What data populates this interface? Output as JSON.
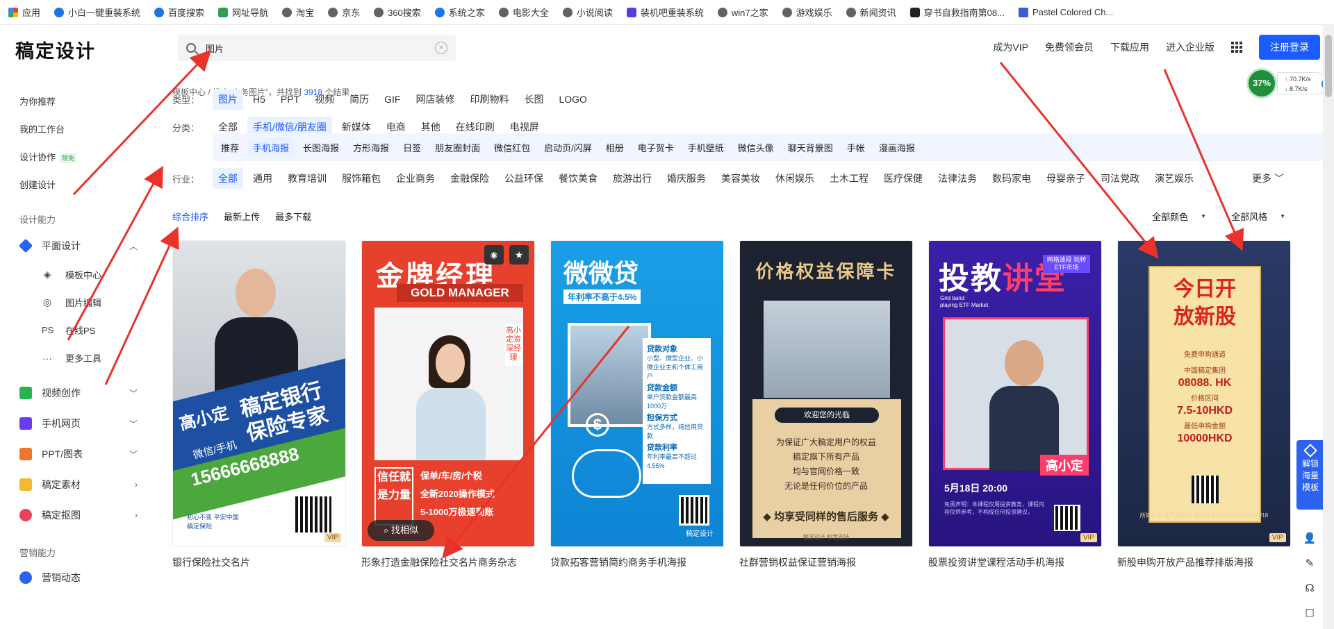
{
  "bookmarks": [
    {
      "label": "应用",
      "icon": "apps-icon"
    },
    {
      "label": "小白一键重装系统",
      "icon": "globe-icon"
    },
    {
      "label": "百度搜索",
      "icon": "baidu-paw-icon"
    },
    {
      "label": "网址导航",
      "icon": "nav-icon"
    },
    {
      "label": "淘宝",
      "icon": "globe-icon"
    },
    {
      "label": "京东",
      "icon": "globe-icon"
    },
    {
      "label": "360搜索",
      "icon": "globe-icon"
    },
    {
      "label": "系统之家",
      "icon": "globe-icon"
    },
    {
      "label": "电影大全",
      "icon": "globe-icon"
    },
    {
      "label": "小说阅读",
      "icon": "globe-icon"
    },
    {
      "label": "装机吧重装系统",
      "icon": "system-icon"
    },
    {
      "label": "win7之家",
      "icon": "globe-icon"
    },
    {
      "label": "游戏娱乐",
      "icon": "globe-icon"
    },
    {
      "label": "新闻资讯",
      "icon": "globe-icon"
    },
    {
      "label": "穿书自救指南第08...",
      "icon": "book-icon"
    },
    {
      "label": "Pastel Colored Ch...",
      "icon": "pastel-icon"
    }
  ],
  "header": {
    "logo": "稿定设计",
    "search_value": "图片",
    "nav": [
      "成为VIP",
      "免费领会员",
      "下载应用",
      "进入企业版"
    ],
    "login": "注册登录"
  },
  "net_widget": {
    "percent": "37%",
    "up": "70.7K/s",
    "down": "8.7K/s"
  },
  "sidebar": {
    "top_items": [
      "为你推荐",
      "我的工作台",
      "设计协作",
      "创建设计"
    ],
    "collab_badge": "限免",
    "section_design": "设计能力",
    "graphic": "平面设计",
    "graphic_subs": [
      "模板中心",
      "图片编辑",
      "在线PS",
      "更多工具"
    ],
    "cats": [
      "视频创作",
      "手机网页",
      "PPT/图表",
      "稿定素材",
      "稿定抠图"
    ],
    "section_marketing": "营销能力",
    "marketing": "营销动态"
  },
  "breadcrumb": {
    "root": "模板中心",
    "sep": " / ",
    "text_a": "搜索“商务图片”，共找到 ",
    "count": "3918",
    "text_b": " 个结果"
  },
  "filters": {
    "type_label": "类型：",
    "types": [
      "图片",
      "H5",
      "PPT",
      "视频",
      "简历",
      "GIF",
      "网店装修",
      "印刷物料",
      "长图",
      "LOGO"
    ],
    "cat_label": "分类：",
    "cats": [
      "全部",
      "手机/微信/朋友圈",
      "新媒体",
      "电商",
      "其他",
      "在线印刷",
      "电视屏"
    ],
    "subcats": [
      "推荐",
      "手机海报",
      "长图海报",
      "方形海报",
      "日签",
      "朋友圈封面",
      "微信红包",
      "启动页/闪屏",
      "相册",
      "电子贺卡",
      "手机壁纸",
      "微信头像",
      "聊天背景图",
      "手帐",
      "漫画海报"
    ],
    "industry_label": "行业：",
    "industries": [
      "全部",
      "通用",
      "教育培训",
      "服饰箱包",
      "企业商务",
      "金融保险",
      "公益环保",
      "餐饮美食",
      "旅游出行",
      "婚庆服务",
      "美容美妆",
      "休闲娱乐",
      "土木工程",
      "医疗保健",
      "法律法务",
      "数码家电",
      "母婴亲子",
      "司法党政",
      "演艺娱乐"
    ],
    "more": "更多"
  },
  "sort": {
    "options": [
      "综合排序",
      "最新上传",
      "最多下载"
    ],
    "color": "全部颜色",
    "style": "全部风格"
  },
  "cards": [
    {
      "title": "银行保险社交名片"
    },
    {
      "title": "形象打造金融保险社交名片商务杂志"
    },
    {
      "title": "贷款拓客营销简约商务手机海报"
    },
    {
      "title": "社群营销权益保证营销海报"
    },
    {
      "title": "股票投资讲堂课程活动手机海报"
    },
    {
      "title": "新股申购开放产品推荐排版海报"
    }
  ],
  "card1": {
    "big": "稿定银行保险专家",
    "name": "高小定",
    "contact": "微信/手机",
    "phone": "15666668888",
    "foot": "初心不变 平安中国\n稿定保险",
    "vip": "VIP"
  },
  "card2": {
    "title": "金牌经理",
    "sub": "GOLD MANAGER",
    "side": "高小定资深经理",
    "leftbox": "信任就是力量",
    "list": [
      "保单/车/房/个税",
      "全新2020操作模式",
      "5-1000万极速到账"
    ],
    "find": "找相似"
  },
  "card3": {
    "title": "微微贷",
    "rate": "年利率不高于4.5%",
    "info": [
      {
        "h": "贷款对象",
        "t": "小型、微型企业、小微企业主和个体工商户"
      },
      {
        "h": "贷款金额",
        "t": "单户贷款金额最高1000万"
      },
      {
        "h": "担保方式",
        "t": "方式多样，纯信用贷款"
      },
      {
        "h": "贷款利率",
        "t": "年利率最高不超过4.55%"
      }
    ],
    "brand": "稿定设计"
  },
  "card4": {
    "title": "价格权益保障卡",
    "pill": "欢迎您的光临",
    "lines": [
      "为保证广大稿定用户的权益",
      "稿定旗下所有产品",
      "均与官网价格一致",
      "无论是任何价位的产品"
    ],
    "bottom": "◆ 均享受同样的售后服务 ◆",
    "foot": "稿定设计 权世支持"
  },
  "card5": {
    "title_a": "投教",
    "title_b": "讲堂",
    "tag": "网格波段 玩转ETF市场",
    "sub": "Grid band\nplaying ETF Market",
    "name": "高小定",
    "date": "5月18日 20:00",
    "small": "免责声明：本课程仅用投资教育，课程内容仅供参考，不构成任何投资建议。",
    "vip": "VIP"
  },
  "card6": {
    "title": "今日开放新股",
    "pairs": [
      {
        "k": "免费申购通道",
        "v": ""
      },
      {
        "k": "中国稿定集团",
        "v": "08088. HK"
      },
      {
        "k": "价格区间",
        "v": "7.5-10HKD"
      },
      {
        "k": "最低申购金额",
        "v": "10000HKD"
      }
    ],
    "small": "所处行业 地产发展商 申购时间 2020/4/10-2020/4/18",
    "vip": "VIP"
  },
  "right_panel": {
    "label": "解锁海量模板"
  },
  "colors": {
    "accent": "#1a5cff",
    "arrow": "#e8322a"
  }
}
